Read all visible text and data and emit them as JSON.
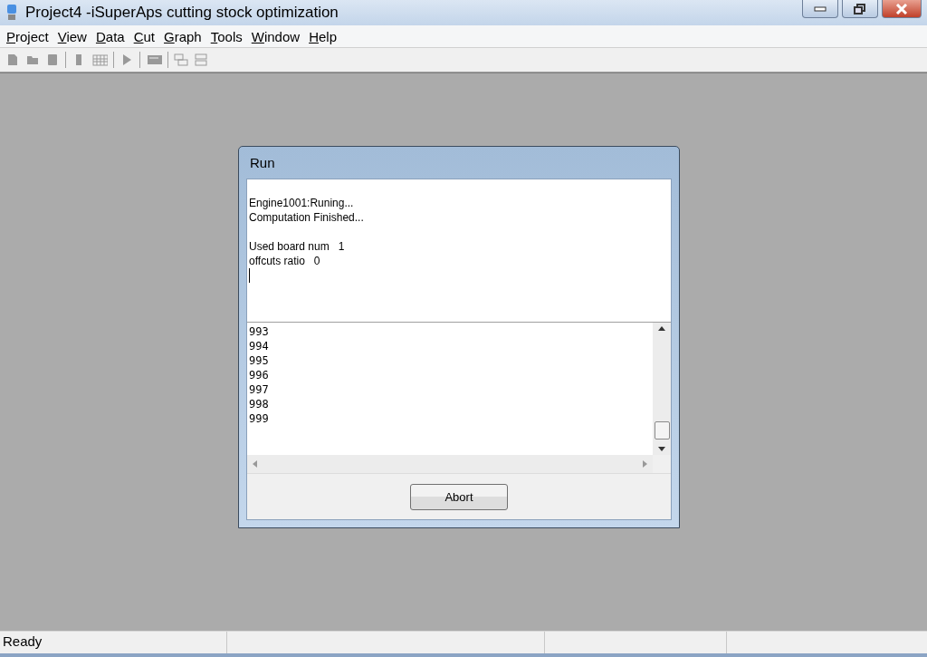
{
  "window": {
    "title": "Project4 -iSuperAps cutting stock optimization"
  },
  "menu": [
    "Project",
    "View",
    "Data",
    "Cut",
    "Graph",
    "Tools",
    "Window",
    "Help"
  ],
  "dialog": {
    "title": "Run",
    "log_blocks": [
      [
        "Engine1001:Runing...",
        "Computation Finished..."
      ],
      [
        "Used board num   1",
        "offcuts ratio   0"
      ]
    ],
    "list_items": [
      "993",
      "994",
      "995",
      "996",
      "997",
      "998",
      "999"
    ],
    "button": "Abort"
  },
  "status_bar": [
    "Ready"
  ]
}
